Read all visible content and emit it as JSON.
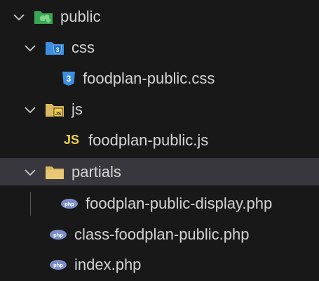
{
  "tree": {
    "public": {
      "label": "public",
      "icon": "folder-public-icon"
    },
    "css": {
      "label": "css",
      "icon": "folder-css-icon"
    },
    "css_file": {
      "label": "foodplan-public.css",
      "icon": "css3-file-icon",
      "badge": "3"
    },
    "js": {
      "label": "js",
      "icon": "folder-js-icon"
    },
    "js_file": {
      "label": "foodplan-public.js",
      "icon": "js-file-icon",
      "badge": "JS"
    },
    "partials": {
      "label": "partials",
      "icon": "folder-icon"
    },
    "display_file": {
      "label": "foodplan-public-display.php",
      "icon": "php-file-icon",
      "badge": "php"
    },
    "class_file": {
      "label": "class-foodplan-public.php",
      "icon": "php-file-icon",
      "badge": "php"
    },
    "index_file": {
      "label": "index.php",
      "icon": "php-file-icon",
      "badge": "php"
    }
  },
  "colors": {
    "background": "#181818",
    "selected_row": "#37373d",
    "text": "#d4d4d4",
    "folder_yellow": "#dcb862",
    "public_green": "#3aa655",
    "css_blue": "#3c8fe1",
    "js_yellow": "#f1d14a",
    "php_purple": "#7b8fc7"
  }
}
